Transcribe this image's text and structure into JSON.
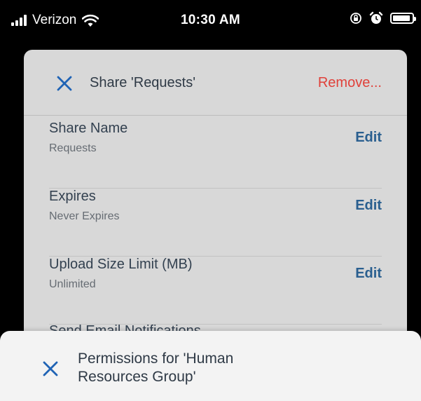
{
  "status_bar": {
    "carrier": "Verizon",
    "time": "10:30 AM",
    "battery_level": 0.92
  },
  "sheet": {
    "title": "Share 'Requests'",
    "remove_label": "Remove...",
    "rows": [
      {
        "label": "Share Name",
        "value": "Requests",
        "action": "Edit"
      },
      {
        "label": "Expires",
        "value": "Never Expires",
        "action": "Edit"
      },
      {
        "label": "Upload Size Limit (MB)",
        "value": "Unlimited",
        "action": "Edit"
      },
      {
        "label": "Send Email Notifications",
        "value": "",
        "action": ""
      }
    ]
  },
  "bottom_panel": {
    "title": "Permissions for 'Human Resources Group'"
  },
  "colors": {
    "accent_blue": "#2a5f8f",
    "close_icon_blue": "#1f63b5",
    "remove_red": "#e0413a"
  },
  "icons": {
    "signal": "cellular-signal-icon",
    "wifi": "wifi-icon",
    "rotation_lock": "rotation-lock-icon",
    "alarm": "alarm-clock-icon",
    "battery": "battery-icon",
    "close": "close-icon"
  }
}
